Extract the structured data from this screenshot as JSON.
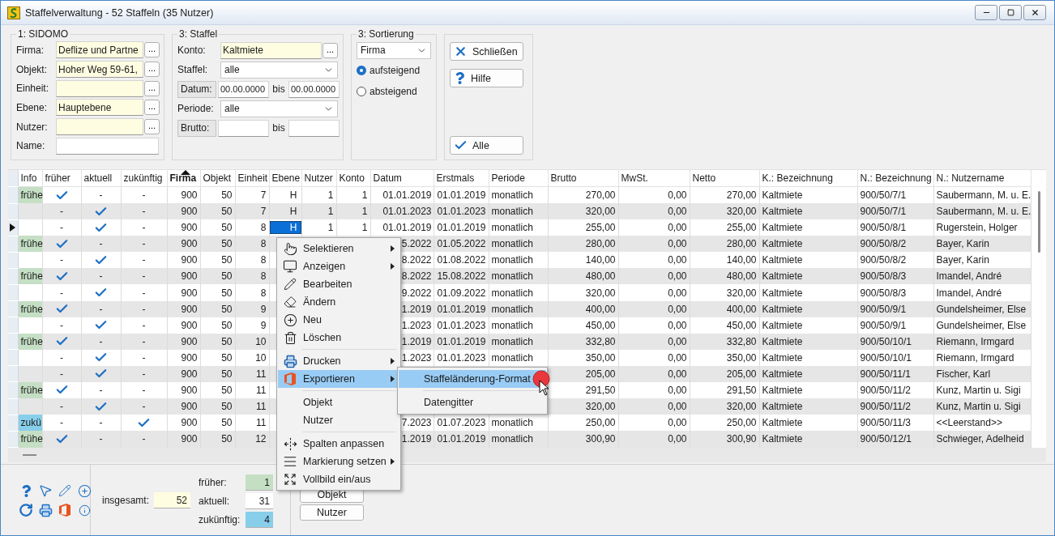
{
  "window": {
    "title": "Staffelverwaltung - 52 Staffeln (35 Nutzer)"
  },
  "sidomo": {
    "legend": "1: SIDOMO",
    "fields": [
      {
        "label": "Firma:",
        "value": "Deflize und Partne",
        "highlighted": true,
        "picker": "..."
      },
      {
        "label": "Objekt:",
        "value": "Hoher Weg 59-61,",
        "highlighted": true,
        "picker": "..."
      },
      {
        "label": "Einheit:",
        "highlighted": true,
        "picker": "..."
      },
      {
        "label": "Ebene:",
        "value": "Hauptebene",
        "highlighted": true,
        "picker": "..."
      },
      {
        "label": "Nutzer:",
        "highlighted": true,
        "picker": "..."
      },
      {
        "label": "Name:",
        "highlighted": false
      }
    ]
  },
  "staffel": {
    "legend": "3: Staffel",
    "rows": [
      {
        "kind": "picker",
        "label": "Konto:",
        "value": "Kaltmiete",
        "picker": "..."
      },
      {
        "kind": "select",
        "label": "Staffel:",
        "value": "alle"
      },
      {
        "kind": "range",
        "label": "Datum:",
        "from": "00.00.0000",
        "separator": "bis",
        "to": "00.00.0000"
      },
      {
        "kind": "select",
        "label": "Periode:",
        "value": "alle"
      },
      {
        "kind": "range",
        "label": "Brutto:",
        "separator": "bis"
      }
    ]
  },
  "sortierung": {
    "legend": "3: Sortierung",
    "select": "Firma",
    "options": [
      {
        "label": "aufsteigend",
        "selected": true
      },
      {
        "label": "absteigend",
        "selected": false
      }
    ]
  },
  "actions": [
    "Schließen",
    "Hilfe",
    "Alle"
  ],
  "table": {
    "columns": [
      {
        "label": "Info",
        "sorted": false
      },
      {
        "label": "früher",
        "sorted": false
      },
      {
        "label": "aktuell",
        "sorted": false
      },
      {
        "label": "zukünftig",
        "sorted": false
      },
      {
        "label": "Firma",
        "sorted": true
      },
      {
        "label": "Objekt",
        "sorted": false
      },
      {
        "label": "Einheit",
        "sorted": false
      },
      {
        "label": "Ebene",
        "sorted": false
      },
      {
        "label": "Nutzer",
        "sorted": false
      },
      {
        "label": "Konto",
        "sorted": false
      },
      {
        "label": "Datum",
        "sorted": false
      },
      {
        "label": "Erstmals",
        "sorted": false
      },
      {
        "label": "Periode",
        "sorted": false
      },
      {
        "label": "Brutto",
        "sorted": false
      },
      {
        "label": "MwSt.",
        "sorted": false
      },
      {
        "label": "Netto",
        "sorted": false
      },
      {
        "label": "K.: Bezeichnung",
        "sorted": false
      },
      {
        "label": "N.: Bezeichnung",
        "sorted": false
      },
      {
        "label": "N.: Nutzername",
        "sorted": false
      }
    ],
    "rows": [
      {
        "current": false,
        "info": {
          "text": "frühe",
          "color": "#c5dfc5"
        },
        "flags": [
          {
            "checked": true
          },
          {
            "checked": false,
            "text": "-"
          },
          {
            "checked": false,
            "text": "-"
          }
        ],
        "firma": "900",
        "objekt": "50",
        "einheit": "7",
        "ebene": {
          "text": "H",
          "selected": false
        },
        "nutzer": "1",
        "konto": "1",
        "datum": "01.01.2019",
        "erstmals": "01.01.2019",
        "periode": "monatlich",
        "brutto": "270,00",
        "mwst": "0,00",
        "netto": "270,00",
        "kbez": "Kaltmiete",
        "nbez": "900/50/7/1",
        "name": "Saubermann, M. u. E."
      },
      {
        "current": false,
        "flags": [
          {
            "checked": false,
            "text": "-"
          },
          {
            "checked": true
          },
          {
            "checked": false,
            "text": "-"
          }
        ],
        "firma": "900",
        "objekt": "50",
        "einheit": "7",
        "ebene": {
          "text": "H",
          "selected": false
        },
        "nutzer": "1",
        "konto": "1",
        "datum": "01.01.2023",
        "erstmals": "01.01.2023",
        "periode": "monatlich",
        "brutto": "320,00",
        "mwst": "0,00",
        "netto": "320,00",
        "kbez": "Kaltmiete",
        "nbez": "900/50/7/1",
        "name": "Saubermann, M. u. E."
      },
      {
        "current": true,
        "flags": [
          {
            "checked": false,
            "text": "-"
          },
          {
            "checked": true
          },
          {
            "checked": false,
            "text": "-"
          }
        ],
        "firma": "900",
        "objekt": "50",
        "einheit": "8",
        "ebene": {
          "text": "H",
          "selected": true
        },
        "nutzer": "1",
        "konto": "1",
        "datum": "01.01.2019",
        "erstmals": "01.01.2019",
        "periode": "monatlich",
        "brutto": "255,00",
        "mwst": "0,00",
        "netto": "255,00",
        "kbez": "Kaltmiete",
        "nbez": "900/50/8/1",
        "name": "Rugerstein, Holger"
      },
      {
        "current": false,
        "info": {
          "text": "frühe",
          "color": "#c5dfc5"
        },
        "flags": [
          {
            "checked": true
          },
          {
            "checked": false,
            "text": "-"
          },
          {
            "checked": false,
            "text": "-"
          }
        ],
        "firma": "900",
        "objekt": "50",
        "einheit": "8",
        "datum": "5.2022",
        "erstmals": "01.05.2022",
        "periode": "monatlich",
        "brutto": "280,00",
        "mwst": "0,00",
        "netto": "280,00",
        "kbez": "Kaltmiete",
        "nbez": "900/50/8/2",
        "name": "Bayer, Karin"
      },
      {
        "current": false,
        "flags": [
          {
            "checked": false,
            "text": "-"
          },
          {
            "checked": true
          },
          {
            "checked": false,
            "text": "-"
          }
        ],
        "firma": "900",
        "objekt": "50",
        "einheit": "8",
        "datum": "8.2022",
        "erstmals": "01.08.2022",
        "periode": "monatlich",
        "brutto": "140,00",
        "mwst": "0,00",
        "netto": "140,00",
        "kbez": "Kaltmiete",
        "nbez": "900/50/8/2",
        "name": "Bayer, Karin"
      },
      {
        "current": false,
        "info": {
          "text": "frühe",
          "color": "#c5dfc5"
        },
        "flags": [
          {
            "checked": true
          },
          {
            "checked": false,
            "text": "-"
          },
          {
            "checked": false,
            "text": "-"
          }
        ],
        "firma": "900",
        "objekt": "50",
        "einheit": "8",
        "datum": "8.2022",
        "erstmals": "15.08.2022",
        "periode": "monatlich",
        "brutto": "480,00",
        "mwst": "0,00",
        "netto": "480,00",
        "kbez": "Kaltmiete",
        "nbez": "900/50/8/3",
        "name": "Imandel, André"
      },
      {
        "current": false,
        "flags": [
          {
            "checked": false,
            "text": "-"
          },
          {
            "checked": true
          },
          {
            "checked": false,
            "text": "-"
          }
        ],
        "firma": "900",
        "objekt": "50",
        "einheit": "8",
        "datum": "9.2022",
        "erstmals": "01.09.2022",
        "periode": "monatlich",
        "brutto": "320,00",
        "mwst": "0,00",
        "netto": "320,00",
        "kbez": "Kaltmiete",
        "nbez": "900/50/8/3",
        "name": "Imandel, André"
      },
      {
        "current": false,
        "info": {
          "text": "frühe",
          "color": "#c5dfc5"
        },
        "flags": [
          {
            "checked": true
          },
          {
            "checked": false,
            "text": "-"
          },
          {
            "checked": false,
            "text": "-"
          }
        ],
        "firma": "900",
        "objekt": "50",
        "einheit": "9",
        "datum": "1.2019",
        "erstmals": "01.01.2019",
        "periode": "monatlich",
        "brutto": "400,00",
        "mwst": "0,00",
        "netto": "400,00",
        "kbez": "Kaltmiete",
        "nbez": "900/50/9/1",
        "name": "Gundelsheimer, Else"
      },
      {
        "current": false,
        "flags": [
          {
            "checked": false,
            "text": "-"
          },
          {
            "checked": true
          },
          {
            "checked": false,
            "text": "-"
          }
        ],
        "firma": "900",
        "objekt": "50",
        "einheit": "9",
        "datum": "1.2023",
        "erstmals": "01.01.2023",
        "periode": "monatlich",
        "brutto": "450,00",
        "mwst": "0,00",
        "netto": "450,00",
        "kbez": "Kaltmiete",
        "nbez": "900/50/9/1",
        "name": "Gundelsheimer, Else"
      },
      {
        "current": false,
        "info": {
          "text": "frühe",
          "color": "#c5dfc5"
        },
        "flags": [
          {
            "checked": true
          },
          {
            "checked": false,
            "text": "-"
          },
          {
            "checked": false,
            "text": "-"
          }
        ],
        "firma": "900",
        "objekt": "50",
        "einheit": "10",
        "datum": "1.2019",
        "erstmals": "01.01.2019",
        "periode": "monatlich",
        "brutto": "332,80",
        "mwst": "0,00",
        "netto": "332,80",
        "kbez": "Kaltmiete",
        "nbez": "900/50/10/1",
        "name": "Riemann, Irmgard"
      },
      {
        "current": false,
        "flags": [
          {
            "checked": false,
            "text": "-"
          },
          {
            "checked": true
          },
          {
            "checked": false,
            "text": "-"
          }
        ],
        "firma": "900",
        "objekt": "50",
        "einheit": "10",
        "datum": "1.2023",
        "erstmals": "01.01.2023",
        "periode": "monatlich",
        "brutto": "350,00",
        "mwst": "0,00",
        "netto": "350,00",
        "kbez": "Kaltmiete",
        "nbez": "900/50/10/1",
        "name": "Riemann, Irmgard"
      },
      {
        "current": false,
        "flags": [
          {
            "checked": false,
            "text": "-"
          },
          {
            "checked": true
          },
          {
            "checked": false,
            "text": "-"
          }
        ],
        "firma": "900",
        "objekt": "50",
        "einheit": "11",
        "brutto": "205,00",
        "mwst": "0,00",
        "netto": "205,00",
        "kbez": "Kaltmiete",
        "nbez": "900/50/11/1",
        "name": "Fischer, Karl"
      },
      {
        "current": false,
        "info": {
          "text": "frühe",
          "color": "#c5dfc5"
        },
        "flags": [
          {
            "checked": true
          },
          {
            "checked": false,
            "text": "-"
          },
          {
            "checked": false,
            "text": "-"
          }
        ],
        "firma": "900",
        "objekt": "50",
        "einheit": "11",
        "brutto": "291,50",
        "mwst": "0,00",
        "netto": "291,50",
        "kbez": "Kaltmiete",
        "nbez": "900/50/11/2",
        "name": "Kunz, Martin u. Sigi"
      },
      {
        "current": false,
        "flags": [
          {
            "checked": false,
            "text": "-"
          },
          {
            "checked": true
          },
          {
            "checked": false,
            "text": "-"
          }
        ],
        "firma": "900",
        "objekt": "50",
        "einheit": "11",
        "brutto": "320,00",
        "mwst": "0,00",
        "netto": "320,00",
        "kbez": "Kaltmiete",
        "nbez": "900/50/11/2",
        "name": "Kunz, Martin u. Sigi"
      },
      {
        "current": false,
        "info": {
          "text": "zukü",
          "color": "#87ceea"
        },
        "flags": [
          {
            "checked": false,
            "text": "-"
          },
          {
            "checked": false,
            "text": "-"
          },
          {
            "checked": true
          }
        ],
        "firma": "900",
        "objekt": "50",
        "einheit": "11",
        "datum": "7.2023",
        "erstmals": "01.07.2023",
        "periode": "monatlich",
        "brutto": "250,00",
        "mwst": "0,00",
        "netto": "250,00",
        "kbez": "Kaltmiete",
        "nbez": "900/50/11/3",
        "name": "<<Leerstand>>"
      },
      {
        "current": false,
        "info": {
          "text": "frühe",
          "color": "#c5dfc5"
        },
        "flags": [
          {
            "checked": true
          },
          {
            "checked": false,
            "text": "-"
          },
          {
            "checked": false,
            "text": "-"
          }
        ],
        "firma": "900",
        "objekt": "50",
        "einheit": "12",
        "datum": "1.2019",
        "erstmals": "01.01.2019",
        "periode": "monatlich",
        "brutto": "300,90",
        "mwst": "0,00",
        "netto": "300,90",
        "kbez": "Kaltmiete",
        "nbez": "900/50/12/1",
        "name": "Schwieger, Adelheid"
      }
    ]
  },
  "context_menu": {
    "items": [
      {
        "kind": "item",
        "label": "Selektieren",
        "submenu": true,
        "selected": false
      },
      {
        "kind": "item",
        "label": "Anzeigen",
        "submenu": true,
        "selected": false
      },
      {
        "kind": "item",
        "label": "Bearbeiten",
        "submenu": false,
        "selected": false
      },
      {
        "kind": "item",
        "label": "Ändern",
        "submenu": false,
        "selected": false
      },
      {
        "kind": "item",
        "label": "Neu",
        "submenu": false,
        "selected": false
      },
      {
        "kind": "item",
        "label": "Löschen",
        "submenu": false,
        "selected": false
      },
      {
        "kind": "separator"
      },
      {
        "kind": "item",
        "label": "Drucken",
        "submenu": true,
        "selected": false
      },
      {
        "kind": "item",
        "label": "Exportieren",
        "submenu": true,
        "selected": true
      },
      {
        "kind": "separator"
      },
      {
        "kind": "item",
        "label": "Objekt",
        "submenu": false,
        "selected": false
      },
      {
        "kind": "item",
        "label": "Nutzer",
        "submenu": false,
        "selected": false
      },
      {
        "kind": "separator"
      },
      {
        "kind": "item",
        "label": "Spalten anpassen",
        "submenu": false,
        "selected": false
      },
      {
        "kind": "item",
        "label": "Markierung setzen",
        "submenu": true,
        "selected": false
      },
      {
        "kind": "item",
        "label": "Vollbild ein/aus",
        "submenu": false,
        "selected": false
      }
    ],
    "submenu": [
      {
        "kind": "item",
        "label": "Staffeländerung-Format",
        "selected": true
      },
      {
        "kind": "separator"
      },
      {
        "kind": "item",
        "label": "Datengitter",
        "selected": false
      }
    ]
  },
  "counts": {
    "total": {
      "label": "insgesamt:",
      "value": "52"
    },
    "breakdown": [
      {
        "label": "früher:",
        "value": "1",
        "color": "#c5dfc5"
      },
      {
        "label": "aktuell:",
        "value": "31",
        "color": "#ffffff"
      },
      {
        "label": "zukünftig:",
        "value": "4",
        "color": "#87ceea"
      }
    ]
  },
  "bottom_buttons": [
    "Objekt",
    "Nutzer"
  ]
}
